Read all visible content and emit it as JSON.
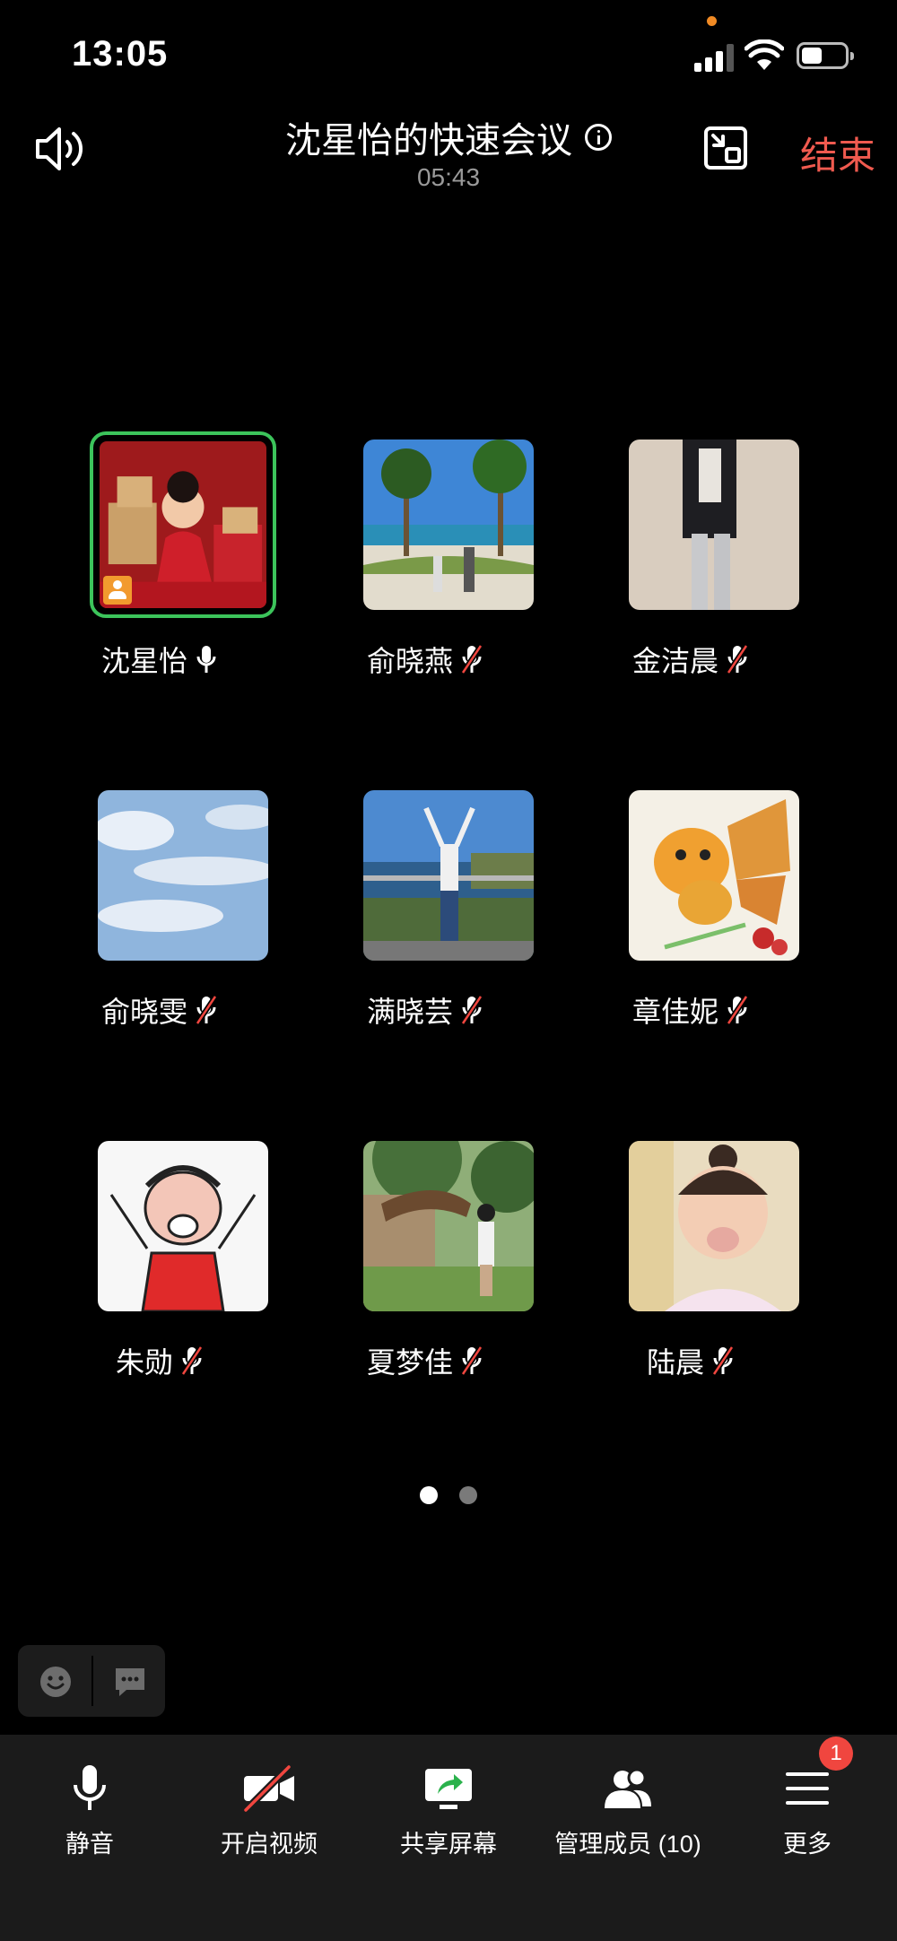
{
  "status_bar": {
    "time": "13:05"
  },
  "header": {
    "title": "沈星怡的快速会议",
    "timer": "05:43",
    "end_label": "结束"
  },
  "participants": [
    {
      "name": "沈星怡",
      "mic": "on",
      "active_speaker": true,
      "host": true
    },
    {
      "name": "俞晓燕",
      "mic": "muted"
    },
    {
      "name": "金洁晨",
      "mic": "muted"
    },
    {
      "name": "俞晓雯",
      "mic": "muted"
    },
    {
      "name": "满晓芸",
      "mic": "muted"
    },
    {
      "name": "章佳妮",
      "mic": "muted"
    },
    {
      "name": "朱勋",
      "mic": "muted"
    },
    {
      "name": "夏梦佳",
      "mic": "muted"
    },
    {
      "name": "陆晨",
      "mic": "muted"
    }
  ],
  "pagination": {
    "current_page": 1,
    "total_pages": 2
  },
  "toolbar": {
    "mute_label": "静音",
    "video_label": "开启视频",
    "share_label": "共享屏幕",
    "members_label": "管理成员 (10)",
    "more_label": "更多",
    "more_badge": "1"
  },
  "colors": {
    "background": "#000000",
    "end_button": "#f05a4f",
    "active_speaker_border": "#3cc45b",
    "host_badge": "#f29a2e",
    "share_icon_arrow": "#2bb24c",
    "notification_badge": "#f0463f",
    "toolbar_bg": "#1b1b1b"
  }
}
